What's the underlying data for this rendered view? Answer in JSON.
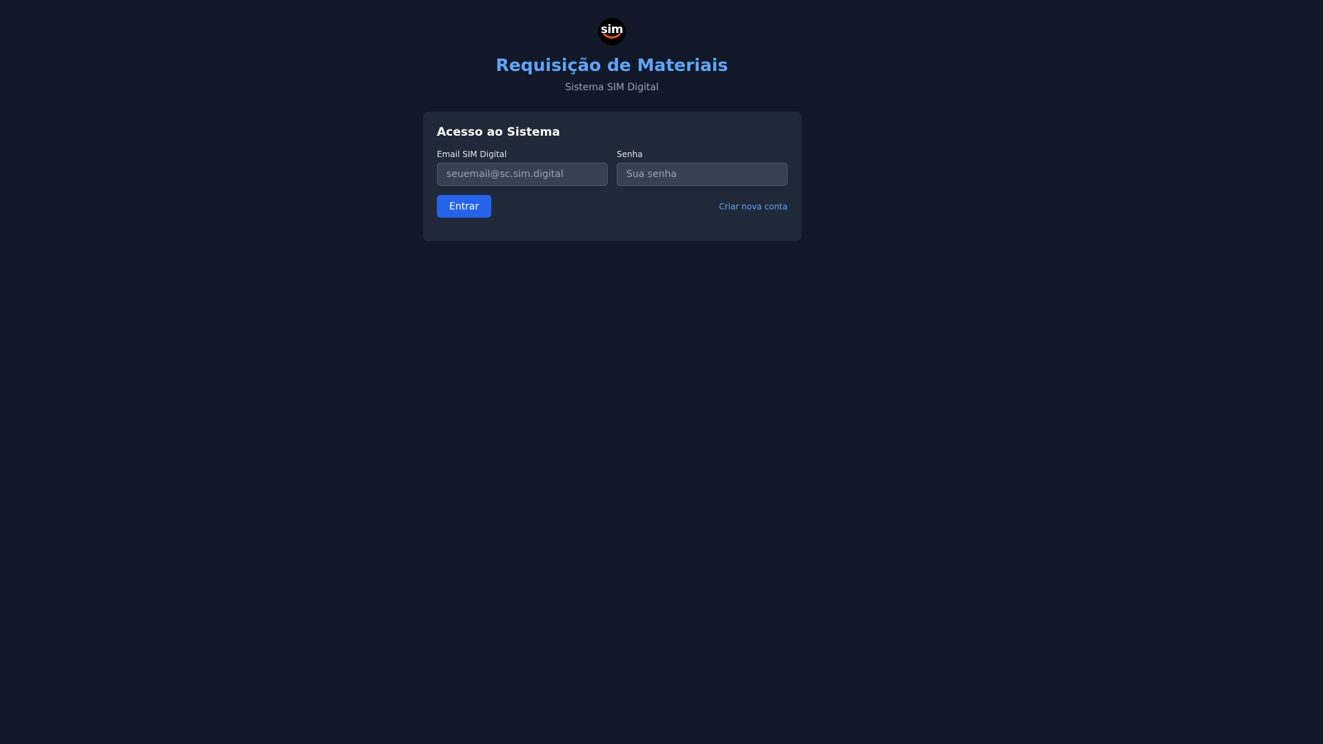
{
  "header": {
    "logo_text": "sim",
    "title": "Requisição de Materiais",
    "subtitle": "Sistema SIM Digital"
  },
  "login": {
    "heading": "Acesso ao Sistema",
    "email_label": "Email SIM Digital",
    "email_placeholder": "seuemail@sc.sim.digital",
    "email_value": "",
    "password_label": "Senha",
    "password_placeholder": "Sua senha",
    "password_value": "",
    "submit_label": "Entrar",
    "create_account_label": "Criar nova conta"
  },
  "icons": {
    "logo": "sim-logo-icon",
    "logo_smile": "smile-arc-icon"
  },
  "colors": {
    "background": "#111827",
    "card": "#1f2937",
    "accent": "#60a5fa",
    "button": "#2563eb",
    "logo_smile": "#ea580c"
  }
}
